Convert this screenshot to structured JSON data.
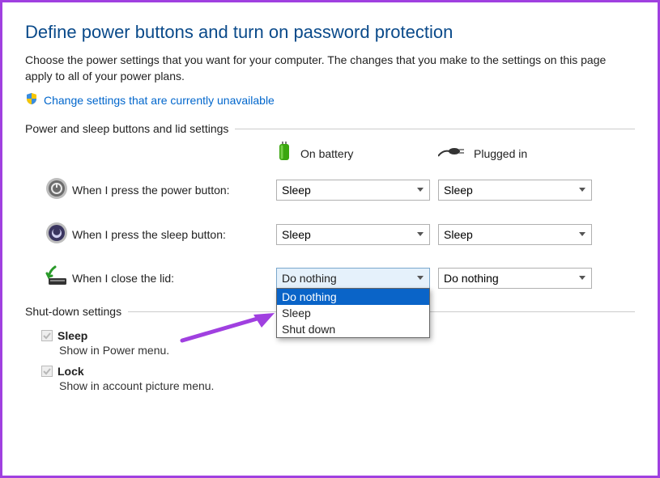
{
  "title": "Define power buttons and turn on password protection",
  "description": "Choose the power settings that you want for your computer. The changes that you make to the settings on this page apply to all of your power plans.",
  "change_link": "Change settings that are currently unavailable",
  "section1": "Power and sleep buttons and lid settings",
  "headers": {
    "battery": "On battery",
    "plugged": "Plugged in"
  },
  "rows": {
    "power": {
      "label": "When I press the power button:",
      "battery": "Sleep",
      "plugged": "Sleep"
    },
    "sleep": {
      "label": "When I press the sleep button:",
      "battery": "Sleep",
      "plugged": "Sleep"
    },
    "lid": {
      "label": "When I close the lid:",
      "battery": "Do nothing",
      "plugged": "Do nothing"
    }
  },
  "lid_options": [
    "Do nothing",
    "Sleep",
    "Shut down"
  ],
  "section2": "Shut-down settings",
  "shutdown": {
    "sleep": {
      "label": "Sleep",
      "sub": "Show in Power menu."
    },
    "lock": {
      "label": "Lock",
      "sub": "Show in account picture menu."
    }
  }
}
